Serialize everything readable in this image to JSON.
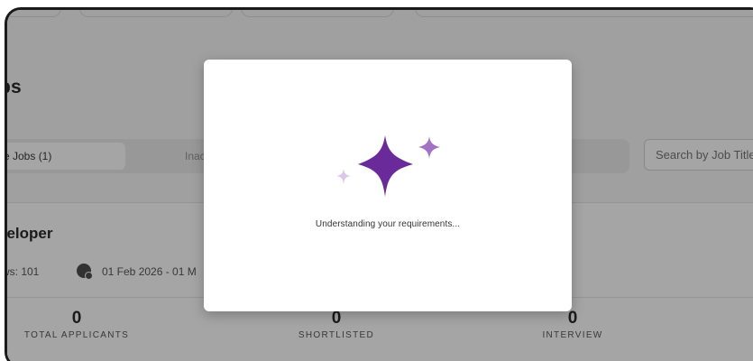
{
  "page": {
    "title": "obs"
  },
  "tabs": {
    "active_label": "e Jobs (1)",
    "inactive_label": "Inac"
  },
  "search": {
    "placeholder": "Search by Job Title"
  },
  "job": {
    "title": "veloper",
    "views": "ws: 101",
    "date_range": "01 Feb 2026 - 01 M",
    "stats": [
      {
        "value": "0",
        "label": "TOTAL APPLICANTS"
      },
      {
        "value": "0",
        "label": "SHORTLISTED"
      },
      {
        "value": "0",
        "label": "INTERVIEW"
      }
    ]
  },
  "modal": {
    "message": "Understanding your requirements...",
    "icon": "sparkles-icon",
    "colors": {
      "primary": "#6b2a9a",
      "secondary": "#a472c4",
      "light": "#dcc6ea"
    }
  }
}
